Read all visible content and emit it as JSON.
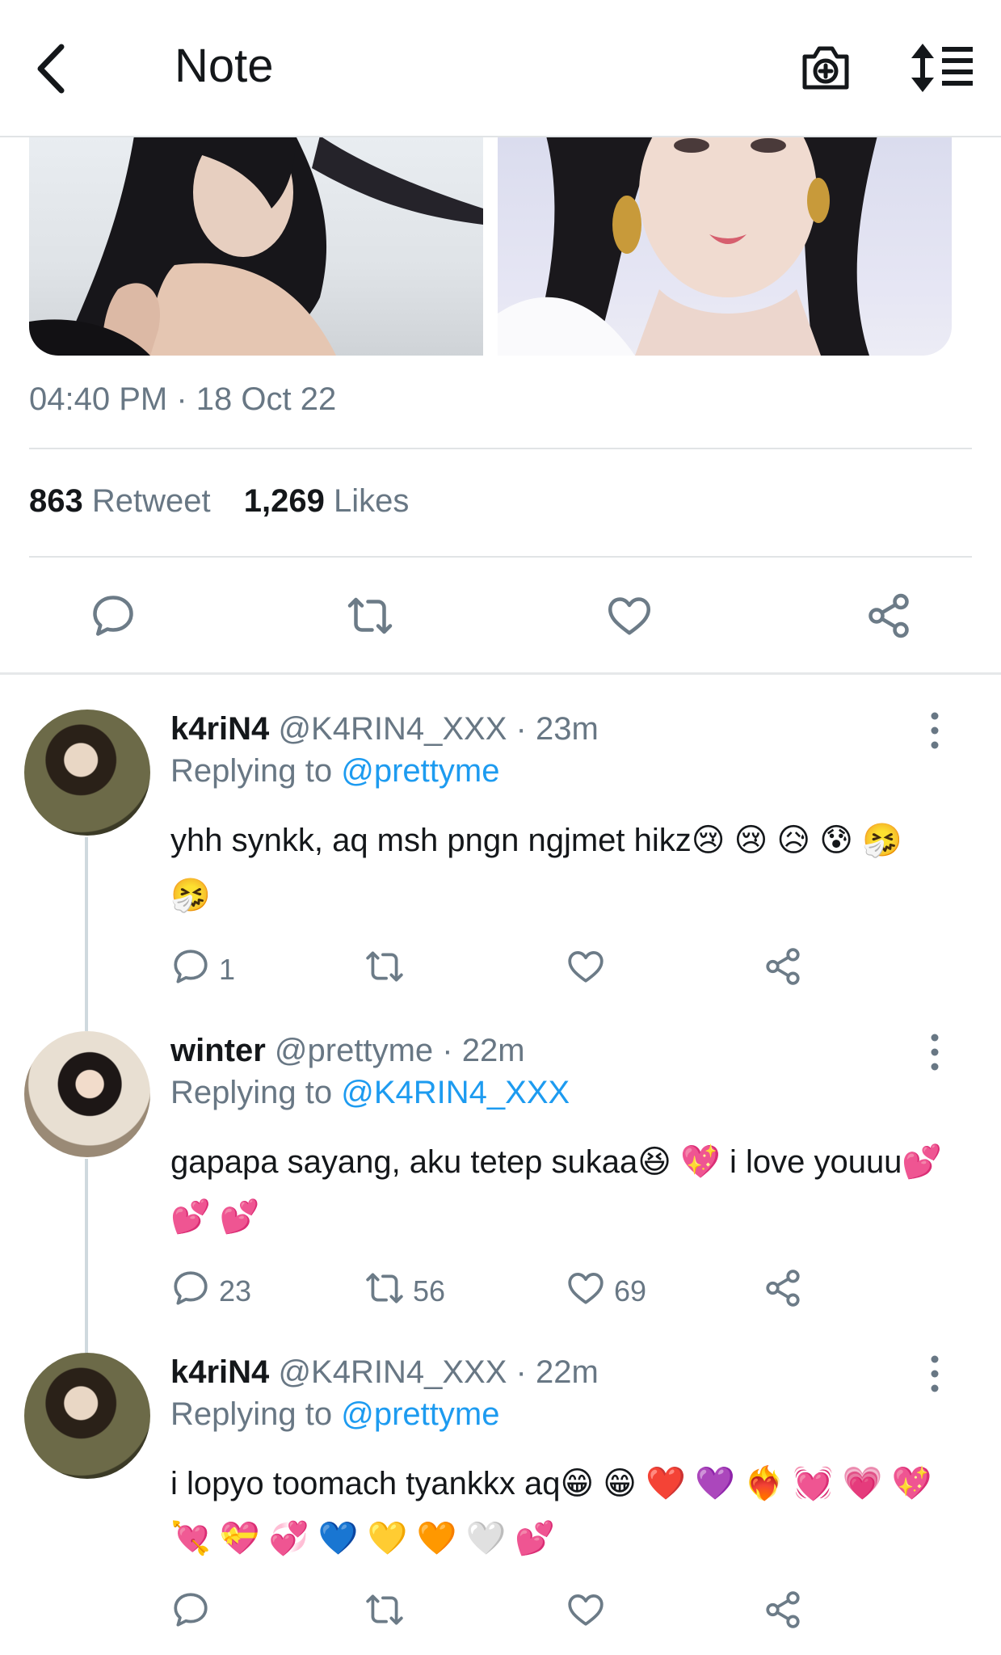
{
  "header": {
    "title": "Note",
    "back_icon": "chevron-left-icon",
    "camera_icon": "camera-add-icon",
    "sort_icon": "sort-list-icon"
  },
  "tweet": {
    "timestamp": "04:40 PM · 18 Oct 22",
    "retweet_count": "863",
    "retweet_label": "Retweet",
    "likes_count": "1,269",
    "likes_label": "Likes"
  },
  "replies": [
    {
      "display_name": "k4riN4",
      "handle": "@K4RIN4_XXX",
      "time": "· 23m",
      "replying_prefix": "Replying to",
      "replying_to": "@prettyme",
      "text": "yhh synkk, aq msh pngn ngjmet hikz😢 😢 😥 😰 🤧 🤧",
      "reply_count": "1",
      "retweet_count": "",
      "like_count": ""
    },
    {
      "display_name": "winter",
      "handle": "@prettyme",
      "time": "· 22m",
      "replying_prefix": "Replying to",
      "replying_to": "@K4RIN4_XXX",
      "text": "gapapa sayang, aku tetep sukaa😆 💖  i love youuu💕 💕 💕",
      "reply_count": "23",
      "retweet_count": "56",
      "like_count": "69"
    },
    {
      "display_name": "k4riN4",
      "handle": "@K4RIN4_XXX",
      "time": "· 22m",
      "replying_prefix": "Replying to",
      "replying_to": "@prettyme",
      "text": "i lopyo toomach tyankkx aq😁 😁 ❤️ 💜 ❤️‍🔥 💓 💗 💖 💘 💝 💞 💙 💛 🧡 🤍 💕",
      "reply_count": "",
      "retweet_count": "",
      "like_count": ""
    }
  ]
}
